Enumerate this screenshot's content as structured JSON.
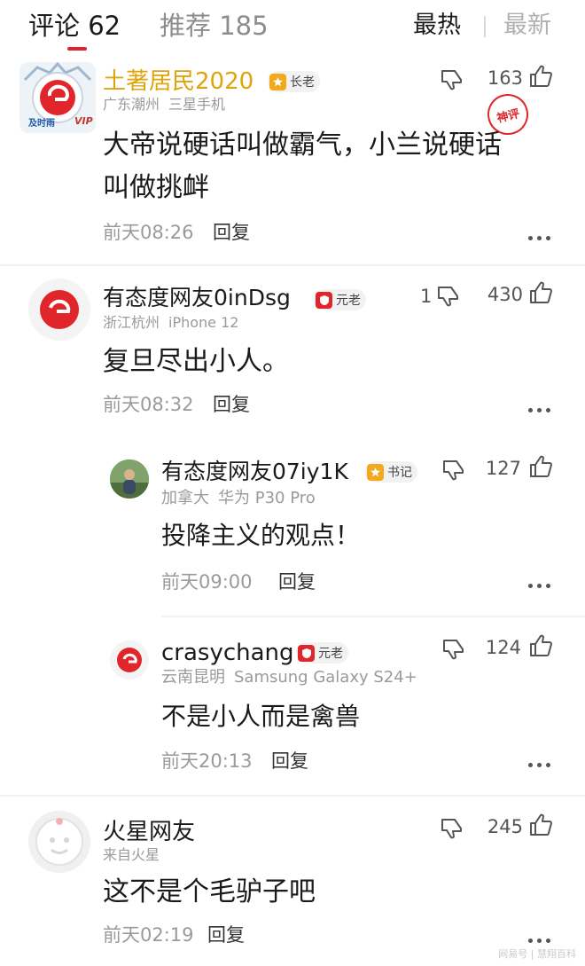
{
  "header": {
    "comments_tab": "评论 62",
    "recommend_tab": "推荐 185",
    "sort_hot": "最热",
    "sort_new": "最新"
  },
  "colors": {
    "accent_red": "#e0262a",
    "gold_name": "#e0a40a",
    "badge_elder_gold": "#f2a91e",
    "badge_red": "#e0262a"
  },
  "comments": [
    {
      "username": "土著居民2020",
      "badge": "长老",
      "badge_icon": "gold-star-badge-icon",
      "location": "广东潮州",
      "device": "三星手机",
      "text_line1": "大帝说硬话叫做霸气，小兰说硬话",
      "text_line2": "叫做挑衅",
      "time": "前天08:26",
      "reply_label": "回复",
      "like_count": "163",
      "stamp": "神评",
      "avatar_tag": "及时雨",
      "vip": "VIP"
    },
    {
      "username": "有态度网友0inDsg",
      "badge": "元老",
      "badge_icon": "red-shield-badge-icon",
      "location": "浙江杭州",
      "device": "iPhone 12",
      "text": "复旦尽出小人。",
      "time": "前天08:32",
      "reply_label": "回复",
      "dislike_count": "1",
      "like_count": "430"
    },
    {
      "username": "有态度网友07iy1K",
      "badge": "书记",
      "badge_icon": "gold-star-badge-icon",
      "location": "加拿大",
      "device": "华为 P30 Pro",
      "text": "投降主义的观点！",
      "time": "前天09:00",
      "reply_label": "回复",
      "like_count": "127"
    },
    {
      "username": "crasychang",
      "badge": "元老",
      "badge_icon": "red-shield-badge-icon",
      "location": "云南昆明",
      "device": "Samsung Galaxy S24+",
      "text": "不是小人而是禽兽",
      "time": "前天20:13",
      "reply_label": "回复",
      "like_count": "124"
    },
    {
      "username": "火星网友",
      "location": "来自火星",
      "text": "这不是个毛驴子吧",
      "time": "前天02:19",
      "reply_label": "回复",
      "like_count": "245"
    }
  ],
  "watermark": "网易号 | 慧翔百科"
}
